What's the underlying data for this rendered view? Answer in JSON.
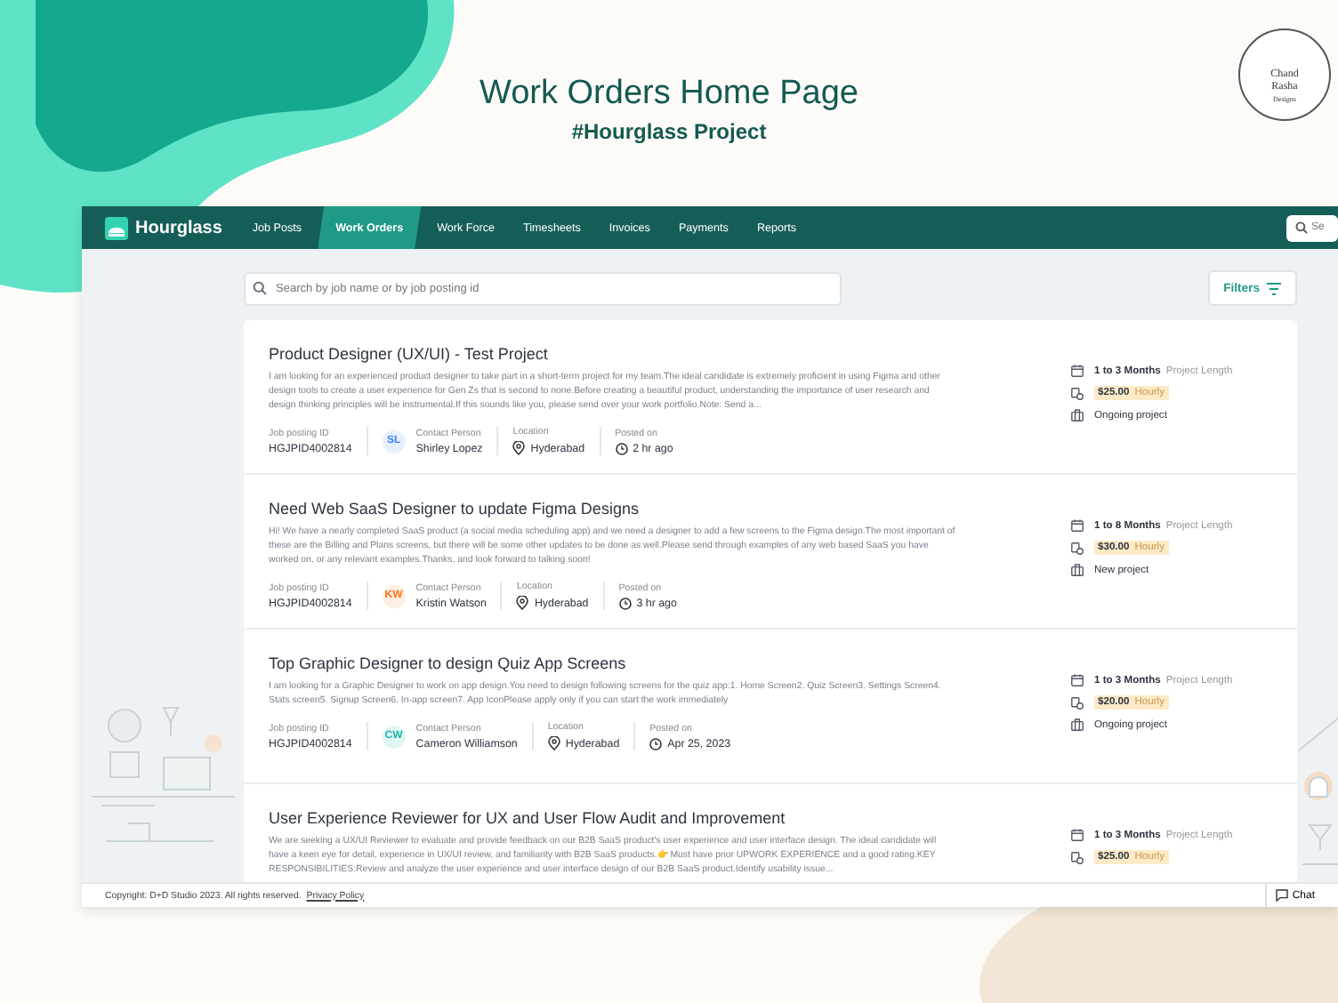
{
  "header": {
    "title": "Work Orders Home Page",
    "subtitle": "#Hourglass Project"
  },
  "studio_logo": {
    "lines": [
      "Chand",
      "Rasha",
      "Designs"
    ]
  },
  "app": {
    "brand": "Hourglass",
    "nav": [
      {
        "label": "Job Posts",
        "selected": false
      },
      {
        "label": "Work Orders",
        "selected": true
      },
      {
        "label": "Work Force",
        "selected": false
      },
      {
        "label": "Timesheets",
        "selected": false
      },
      {
        "label": "Invoices",
        "selected": false
      },
      {
        "label": "Payments",
        "selected": false
      },
      {
        "label": "Reports",
        "selected": false
      }
    ],
    "top_search": {
      "placeholder": "Se"
    },
    "search": {
      "placeholder": "Search by job name or by job posting id"
    },
    "filters": "Filters",
    "jobs": [
      {
        "title": "Product Designer (UX/UI) - Test Project",
        "description": "I am looking for an experienced product designer to take part in a short-term project for my team.The ideal candidate is extremely proficient in using Figma and other design tools to create a user experience for Gen Zs that is second to none.Before creating a beautiful product, understanding the importance of user research and design thinking principles will be instrumental.If this sounds like you, please send over your work portfolio.Note: Send a...",
        "posting_id_label": "Job posting ID",
        "posting_id": "HGJPID4002814",
        "contact_label": "Contact Person",
        "initials": "SL",
        "color": "#3b82f6",
        "contact": "Shirley Lopez",
        "location_label": "Location",
        "location": "Hyderabad",
        "posted_label": "Posted on",
        "posted": "2 hr ago",
        "duration": "1 to 3 Months",
        "duration_label": "Project Length",
        "rate": "$25.00",
        "rate_label": "Hourly",
        "status": "Ongoing project"
      },
      {
        "title": "Need Web SaaS Designer to update Figma Designs",
        "description": "Hi! We have a nearly completed SaaS product (a social media scheduling app) and we need a designer to add a few screens to the Figma design.The most important of these are the Billing and Plans screens, but there will be some other updates to be done as well.Please send through examples of any web based SaaS you have worked on, or any relevant examples.Thanks, and look forward to talking soon!",
        "posting_id_label": "Job posting ID",
        "posting_id": "HGJPID4002814",
        "contact_label": "Contact Person",
        "initials": "KW",
        "color": "#f97316",
        "contact": "Kristin Watson",
        "location_label": "Location",
        "location": "Hyderabad",
        "posted_label": "Posted on",
        "posted": "3 hr ago",
        "duration": "1 to 8 Months",
        "duration_label": "Project Length",
        "rate": "$30.00",
        "rate_label": "Hourly",
        "status": "New project"
      },
      {
        "title": "Top Graphic Designer to design Quiz App Screens",
        "description": "I am looking for a Graphic Designer to work on app design.You need to design following screens for the quiz app:1. Home Screen2. Quiz Screen3. Settings Screen4. Stats screen5. Signup Screen6. In-app screen7. App IconPlease apply only if you can start the work immediately",
        "posting_id_label": "Job posting ID",
        "posting_id": "HGJPID4002814",
        "contact_label": "Contact Person",
        "initials": "CW",
        "color": "#14b8a6",
        "contact": "Cameron Williamson",
        "location_label": "Location",
        "location": "Hyderabad",
        "posted_label": "Posted on",
        "posted": "Apr 25, 2023",
        "duration": "1 to 3 Months",
        "duration_label": "Project Length",
        "rate": "$20.00",
        "rate_label": "Hourly",
        "status": "Ongoing project"
      },
      {
        "title": "User Experience Reviewer for UX and User Flow Audit and Improvement",
        "description": "We are seeking a UX/UI Reviewer to evaluate and provide feedback on our B2B SaaS product's user experience and user interface design. The ideal candidate will have a keen eye for detail, experience in UX/UI review, and familiarity with B2B SaaS products.👉 Must have prior UPWORK EXPERIENCE and a good rating.KEY RESPONSIBILITIES:Review and analyze the user experience and user interface design of our B2B SaaS product.Identify usability issue...",
        "duration": "1 to 3 Months",
        "duration_label": "Project Length",
        "rate": "$25.00",
        "rate_label": "Hourly"
      }
    ],
    "footer": {
      "copyright": "Copyright: D+D Studio 2023. All rights reserved.",
      "link": "Privacy Policy",
      "chat": "Chat"
    }
  }
}
